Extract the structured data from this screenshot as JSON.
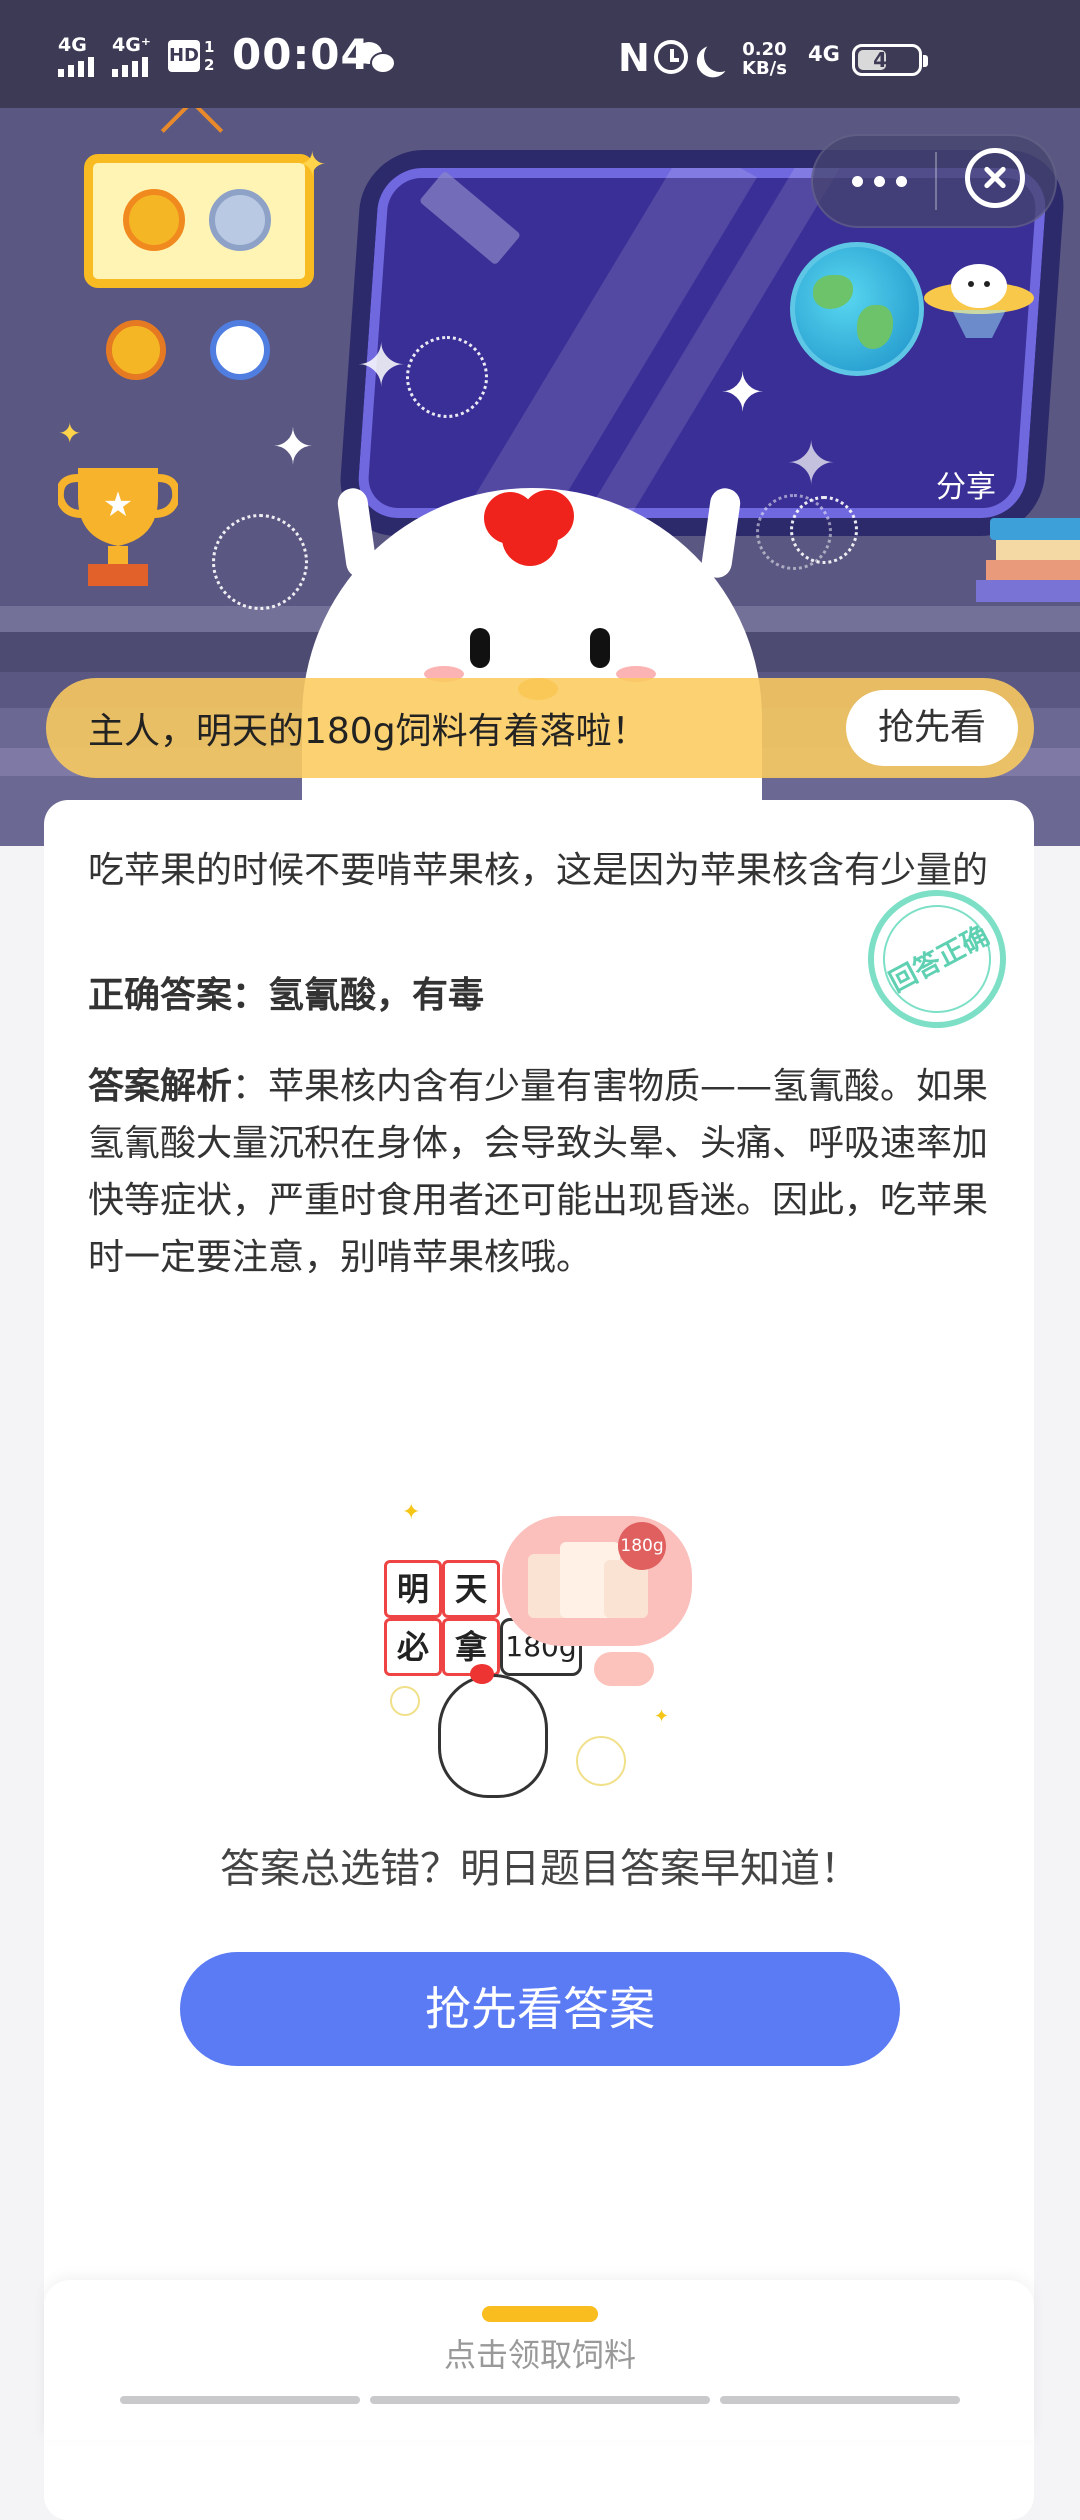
{
  "status_bar": {
    "network_1": "4G",
    "network_2": "4G⁺",
    "hd_label": "HD",
    "hd_sub_1": "1",
    "hd_sub_2": "2",
    "time": "00:04",
    "net_speed_value": "0.20",
    "net_speed_unit": "KB/s",
    "network_3": "4G",
    "battery": "44",
    "icons": [
      "signal-icon",
      "signal-icon",
      "hd-icon",
      "wechat-icon",
      "nfc-icon",
      "alarm-icon",
      "moon-icon",
      "battery-icon"
    ]
  },
  "header": {
    "share_label": "分享"
  },
  "tips_bar": {
    "text": "主人，明天的180g饲料有着落啦！",
    "button": "抢先看"
  },
  "card": {
    "question": "吃苹果的时候不要啃苹果核，这是因为苹果核含有少量的",
    "correct_answer": "正确答案：氢氰酸，有毒",
    "stamp": "回答正确",
    "analysis_label": "答案解析",
    "analysis_text": "：苹果核内含有少量有害物质——氢氰酸。如果氢氰酸大量沉积在身体，会导致头晕、头痛、呼吸速率加快等症状，严重时食用者还可能出现昏迷。因此，吃苹果时一定要注意，别啃苹果核哦。"
  },
  "promo": {
    "tiles": [
      "明",
      "天",
      "必",
      "拿"
    ],
    "amount_badge": "180g",
    "bag_badge": "180g",
    "text": "答案总选错？明日题目答案早知道！",
    "button": "抢先看答案"
  },
  "bottom_panel": {
    "label": "点击领取饲料"
  },
  "colors": {
    "status_bar_bg": "#3c3a55",
    "hero_bg": "#5a5782",
    "tips_bar_bg": "#facb5f",
    "cta_bg": "#5b7bf5",
    "stamp_green": "#7de0c6",
    "grab_bar": "#f9bd1f"
  }
}
